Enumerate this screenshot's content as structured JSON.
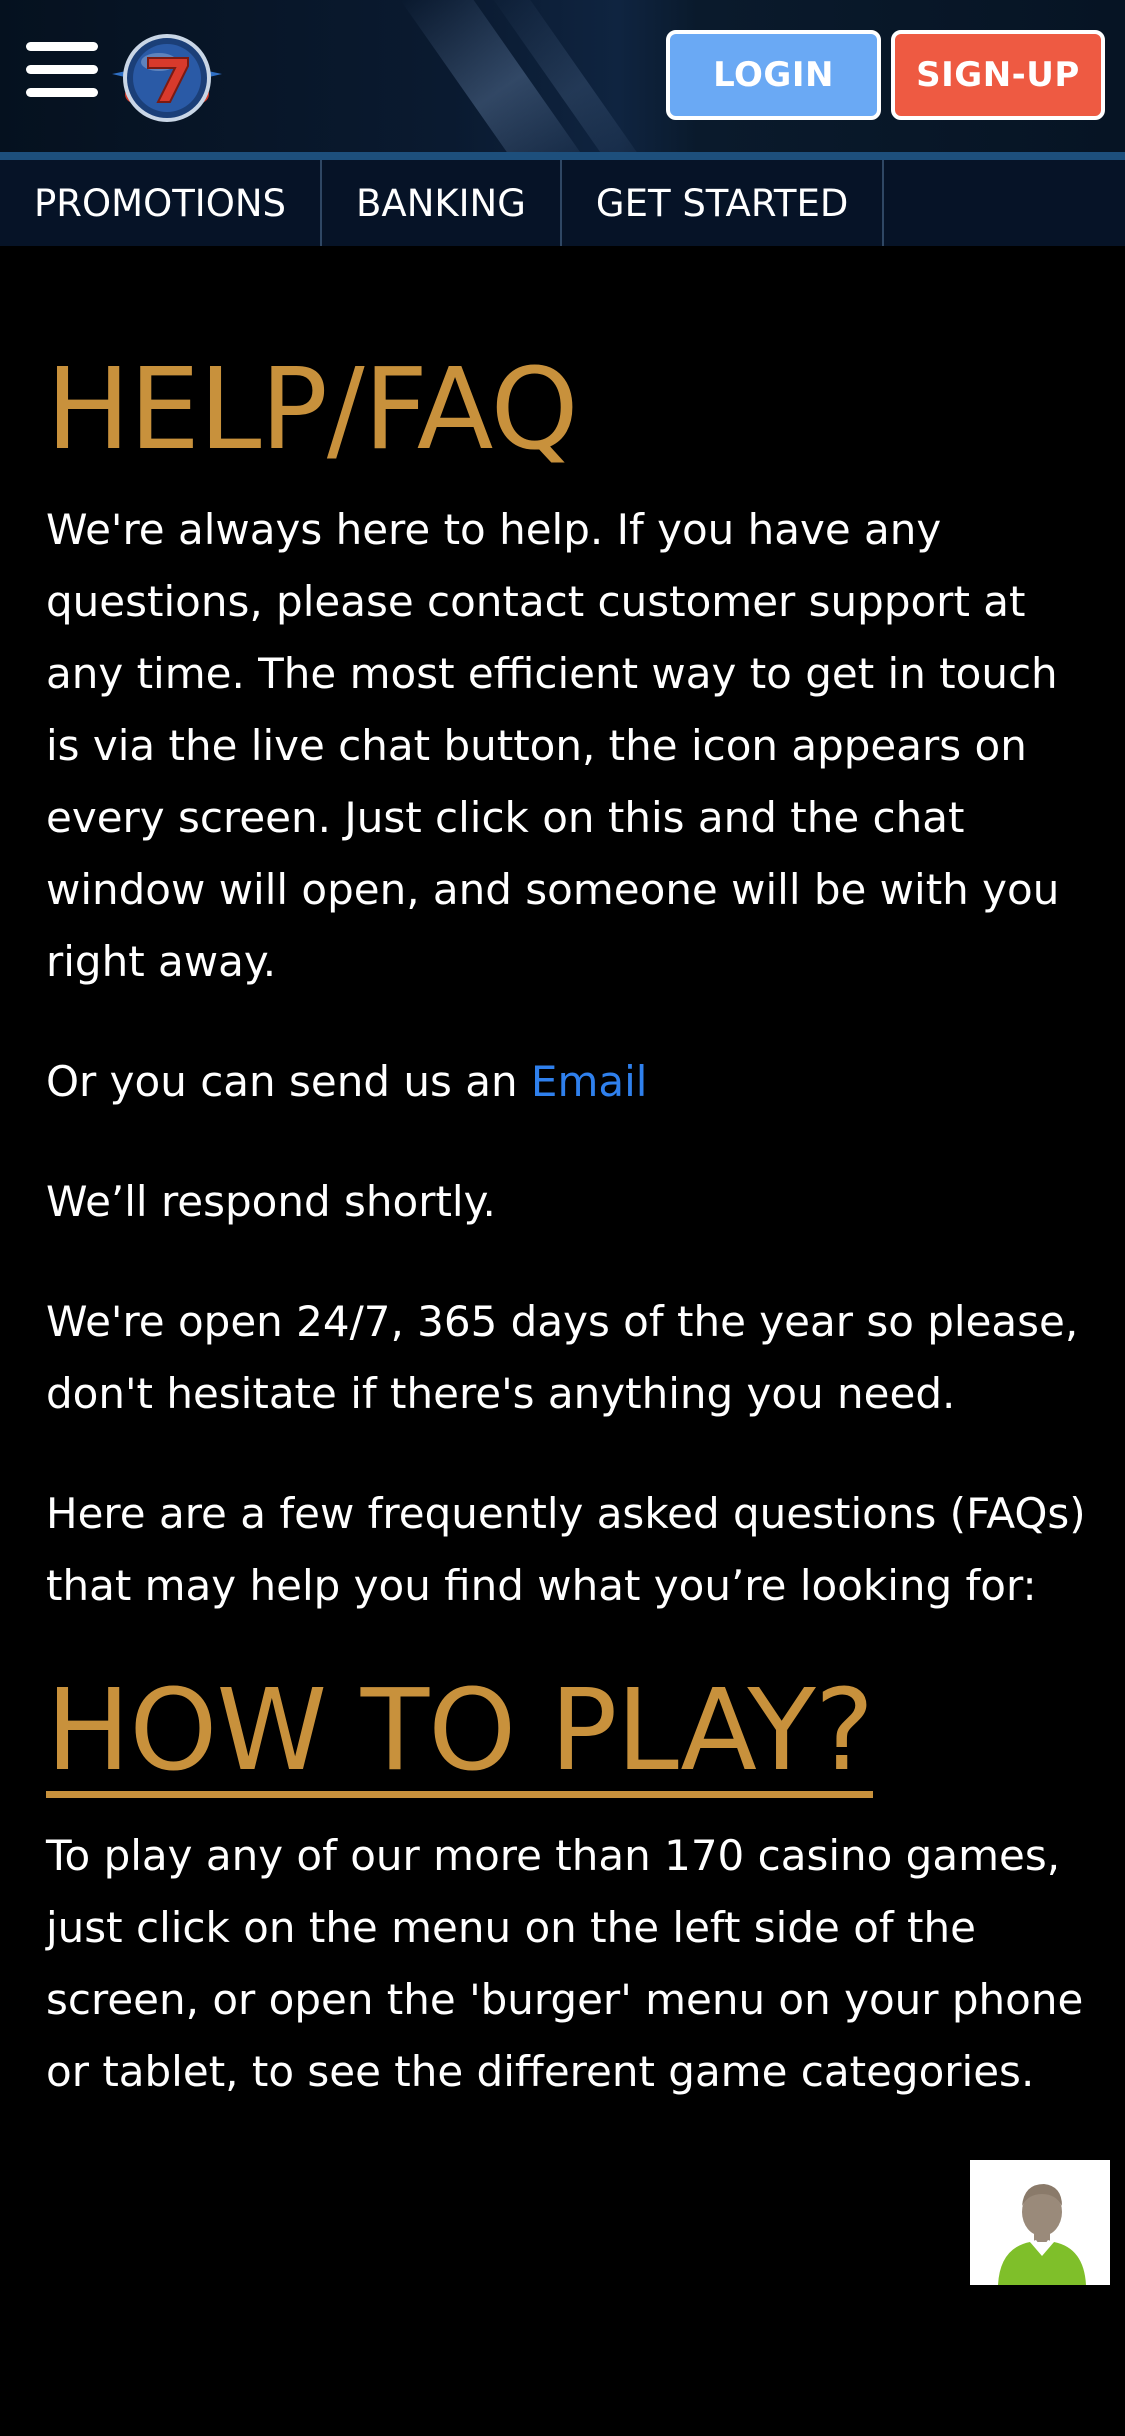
{
  "header": {
    "menu_icon": "hamburger-menu-icon",
    "logo_icon": "lucky-seven-logo-icon",
    "login_label": "LOGIN",
    "signup_label": "SIGN-UP",
    "colors": {
      "login_bg": "#6aa9f4",
      "signup_bg": "#ee5a42",
      "header_bg": "#0a1a30"
    }
  },
  "nav": {
    "items": [
      {
        "label": "PROMOTIONS"
      },
      {
        "label": "BANKING"
      },
      {
        "label": "GET STARTED"
      }
    ]
  },
  "main": {
    "title": "HELP/FAQ",
    "intro": "We're always here to help. If you have any questions, please contact customer support at any time. The most efficient way to get in touch is via the live chat button, the icon appears on every screen. Just click on this and the chat window will open, and someone will be with you right away.",
    "email_prefix": "Or you can send us an ",
    "email_link": "Email",
    "respond": "We’ll respond shortly.",
    "open_hours": "We're open 24/7, 365 days of the year so please, don't hesitate if there's anything you need.",
    "faq_intro": "Here are a few frequently asked questions (FAQs) that may help you find what you’re looking for:",
    "section_title": "HOW TO PLAY?",
    "how_to_play": "To play any of our more than 170 casino games, just click on the menu on the left side of the screen, or open the 'burger' menu on your phone or tablet, to see the different game categories.",
    "colors": {
      "heading": "#c8913c",
      "link": "#2f80ed",
      "text": "#ffffff",
      "background": "#000000"
    }
  },
  "chat": {
    "icon": "live-chat-agent-icon"
  }
}
